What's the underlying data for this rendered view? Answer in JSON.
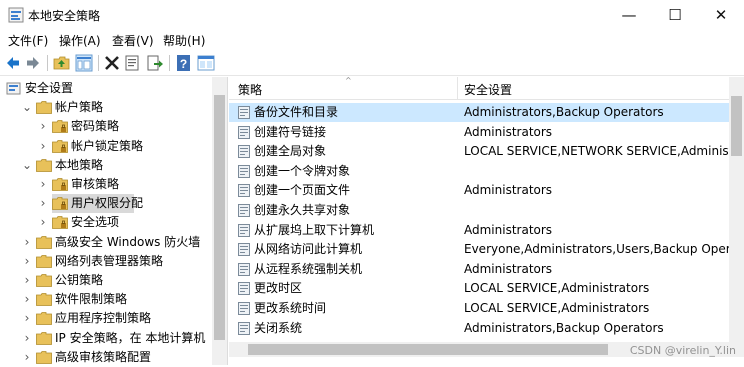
{
  "window": {
    "title": "本地安全策略",
    "controls": {
      "minimize": "—",
      "maximize": "☐",
      "close": "✕"
    }
  },
  "menu": [
    "文件(F)",
    "操作(A)",
    "查看(V)",
    "帮助(H)"
  ],
  "toolbar": [
    "back-icon",
    "forward-icon",
    "up-folder-icon",
    "show-hide-tree-icon",
    "delete-icon",
    "properties-icon",
    "export-icon",
    "help-icon",
    "console-icon"
  ],
  "tree": [
    {
      "label": "安全设置",
      "level": 0,
      "expanded": true
    },
    {
      "label": "帐户策略",
      "level": 1,
      "expanded": true
    },
    {
      "label": "密码策略",
      "level": 2,
      "expanded": false
    },
    {
      "label": "帐户锁定策略",
      "level": 2,
      "expanded": false
    },
    {
      "label": "本地策略",
      "level": 1,
      "expanded": true
    },
    {
      "label": "审核策略",
      "level": 2,
      "expanded": false
    },
    {
      "label": "用户权限分配",
      "level": 2,
      "expanded": false,
      "selected": true
    },
    {
      "label": "安全选项",
      "level": 2,
      "expanded": false
    },
    {
      "label": "高级安全 Windows 防火墙",
      "level": 1,
      "expanded": false
    },
    {
      "label": "网络列表管理器策略",
      "level": 1,
      "expanded": false
    },
    {
      "label": "公钥策略",
      "level": 1,
      "expanded": false
    },
    {
      "label": "软件限制策略",
      "level": 1,
      "expanded": false
    },
    {
      "label": "应用程序控制策略",
      "level": 1,
      "expanded": false
    },
    {
      "label": "IP 安全策略，在 本地计算机",
      "level": 1,
      "expanded": false
    },
    {
      "label": "高级审核策略配置",
      "level": 1,
      "expanded": false
    }
  ],
  "columns": {
    "policy": "策略",
    "security": "安全设置"
  },
  "rows": [
    {
      "policy": "备份文件和目录",
      "setting": "Administrators,Backup Operators",
      "selected": true
    },
    {
      "policy": "创建符号链接",
      "setting": "Administrators"
    },
    {
      "policy": "创建全局对象",
      "setting": "LOCAL SERVICE,NETWORK SERVICE,Administrators"
    },
    {
      "policy": "创建一个令牌对象",
      "setting": ""
    },
    {
      "policy": "创建一个页面文件",
      "setting": "Administrators"
    },
    {
      "policy": "创建永久共享对象",
      "setting": ""
    },
    {
      "policy": "从扩展坞上取下计算机",
      "setting": "Administrators"
    },
    {
      "policy": "从网络访问此计算机",
      "setting": "Everyone,Administrators,Users,Backup Operators"
    },
    {
      "policy": "从远程系统强制关机",
      "setting": "Administrators"
    },
    {
      "policy": "更改时区",
      "setting": "LOCAL SERVICE,Administrators"
    },
    {
      "policy": "更改系统时间",
      "setting": "LOCAL SERVICE,Administrators"
    },
    {
      "policy": "关闭系统",
      "setting": "Administrators,Backup Operators"
    }
  ],
  "watermark": "CSDN @virelin_Y.lin",
  "colors": {
    "selection": "#cce8ff",
    "tree_selection": "#d9d9d9",
    "folder": "#e8c15a",
    "toolbar_blue": "#1a73c9"
  }
}
